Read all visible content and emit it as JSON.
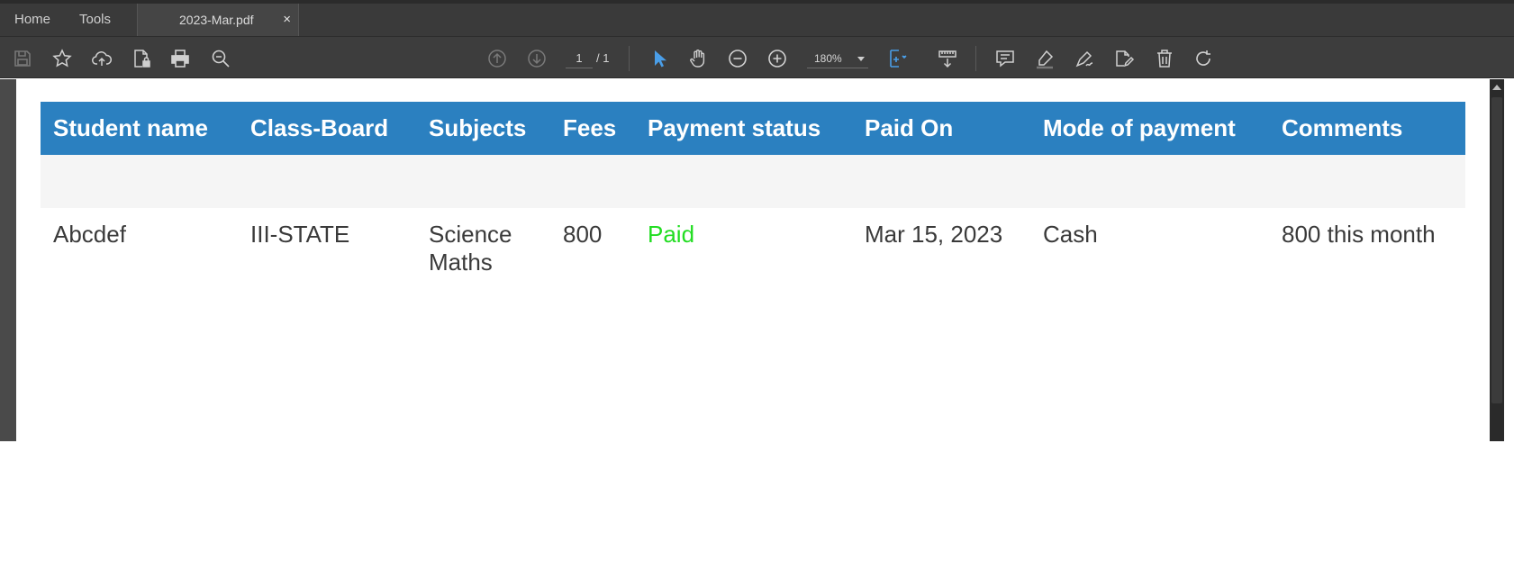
{
  "tabbar": {
    "home_label": "Home",
    "tools_label": "Tools",
    "doc_tab_title": "2023-Mar.pdf",
    "close_glyph": "×"
  },
  "toolbar": {
    "left_icons": [
      "save-icon",
      "star-icon",
      "cloud-upload-icon",
      "protect-file-icon",
      "print-icon",
      "zoom-search-icon"
    ],
    "page_current": "1",
    "page_total": "/ 1",
    "zoom_value": "180%",
    "right_icons": [
      "select-cursor-icon",
      "hand-icon",
      "zoom-out-icon",
      "zoom-in-icon",
      "fit-page-icon",
      "scroll-mode-icon",
      "comment-icon",
      "highlight-icon",
      "sign-icon",
      "edit-pdf-icon",
      "delete-icon",
      "rotate-icon"
    ]
  },
  "table": {
    "headers": [
      "Student name",
      "Class-Board",
      "Subjects",
      "Fees",
      "Payment status",
      "Paid On",
      "Mode of payment",
      "Comments"
    ],
    "row": {
      "student_name": "Abcdef",
      "class_board": "III-STATE",
      "subjects_line1": "Science",
      "subjects_line2": "Maths",
      "fees": "800",
      "payment_status": "Paid",
      "paid_on": "Mar 15, 2023",
      "mode_of_payment": "Cash",
      "comments": "800 this month"
    }
  },
  "colors": {
    "header_bg": "#2b80c0",
    "paid_color": "#22dd22",
    "accent_blue": "#4a9ee8"
  }
}
